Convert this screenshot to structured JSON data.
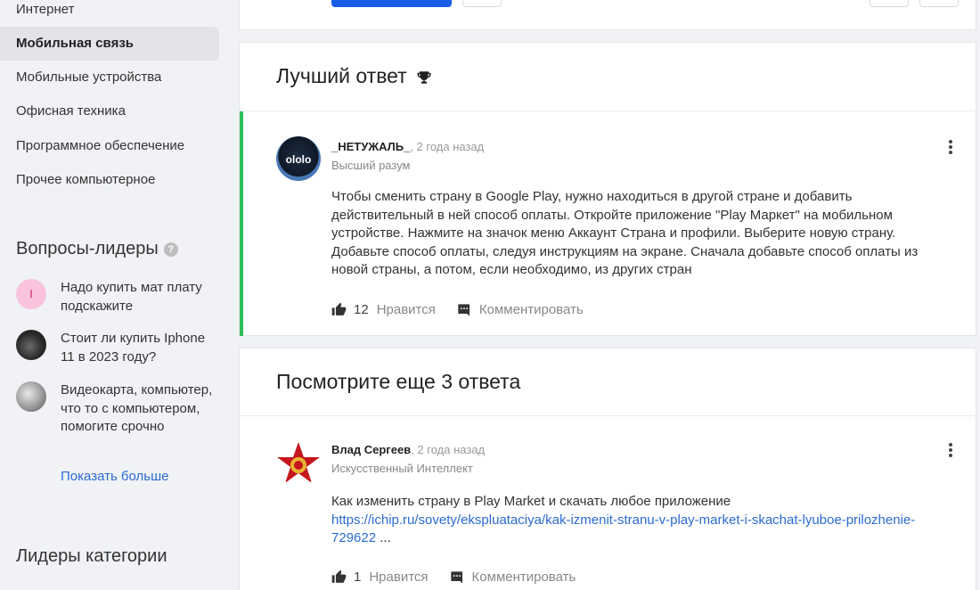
{
  "sidebar": {
    "categories": [
      {
        "label": "Интернет",
        "active": false
      },
      {
        "label": "Мобильная связь",
        "active": true
      },
      {
        "label": "Мобильные устройства",
        "active": false
      },
      {
        "label": "Офисная техника",
        "active": false
      },
      {
        "label": "Программное обеспечение",
        "active": false
      },
      {
        "label": "Прочее компьютерное",
        "active": false
      }
    ],
    "leader_questions_title": "Вопросы-лидеры",
    "help_icon": "?",
    "leader_questions": [
      {
        "text": "Надо купить мат плату подскажите",
        "avatar_letter": "I",
        "avatar_color": "#f9c3de"
      },
      {
        "text": "Стоит ли купить Iphone 11 в 2023 году?",
        "avatar_color": "#3c3c3c"
      },
      {
        "text": "Видеокарта, компьютер, что то с компьютером, помогите срочно",
        "avatar_color": "#8a8a8a"
      }
    ],
    "show_more": "Показать больше",
    "category_leaders_title": "Лидеры категории"
  },
  "best_answer": {
    "title": "Лучший ответ",
    "author": "_НЕТУЖАЛЬ_",
    "time": ", 2 года назад",
    "rank": "Высший разум",
    "avatar_text": "ololo",
    "text": "Чтобы сменить страну в Google Play, нужно находиться в другой стране и добавить действительный в ней способ оплаты. Откройте приложение \"Play Маркет\" на мобильном устройстве. Нажмите на значок меню Аккаунт Страна и профили. Выберите новую страну. Добавьте способ оплаты, следуя инструкциям на экране. Сначала добавьте способ оплаты из новой страны, а потом, если необходимо, из других стран",
    "likes": "12",
    "like_label": "Нравится",
    "comment_label": "Комментировать"
  },
  "more_answers": {
    "title": "Посмотрите еще 3 ответа",
    "answer": {
      "author": "Влад Сергеев",
      "time": ", 2 года назад",
      "rank": "Искусственный Интеллект",
      "text": "Как изменить страну в Play Market и скачать любое приложение",
      "link": "https://ichip.ru/sovety/ekspluataciya/kak-izmenit-stranu-v-play-market-i-skachat-lyuboe-prilozhenie-729622",
      "ellipsis": "...",
      "likes": "1",
      "like_label": "Нравится",
      "comment_label": "Комментировать"
    }
  },
  "colors": {
    "accent": "#1a5ee8",
    "best_border": "#2ebd5c",
    "link": "#2a6bd4"
  }
}
